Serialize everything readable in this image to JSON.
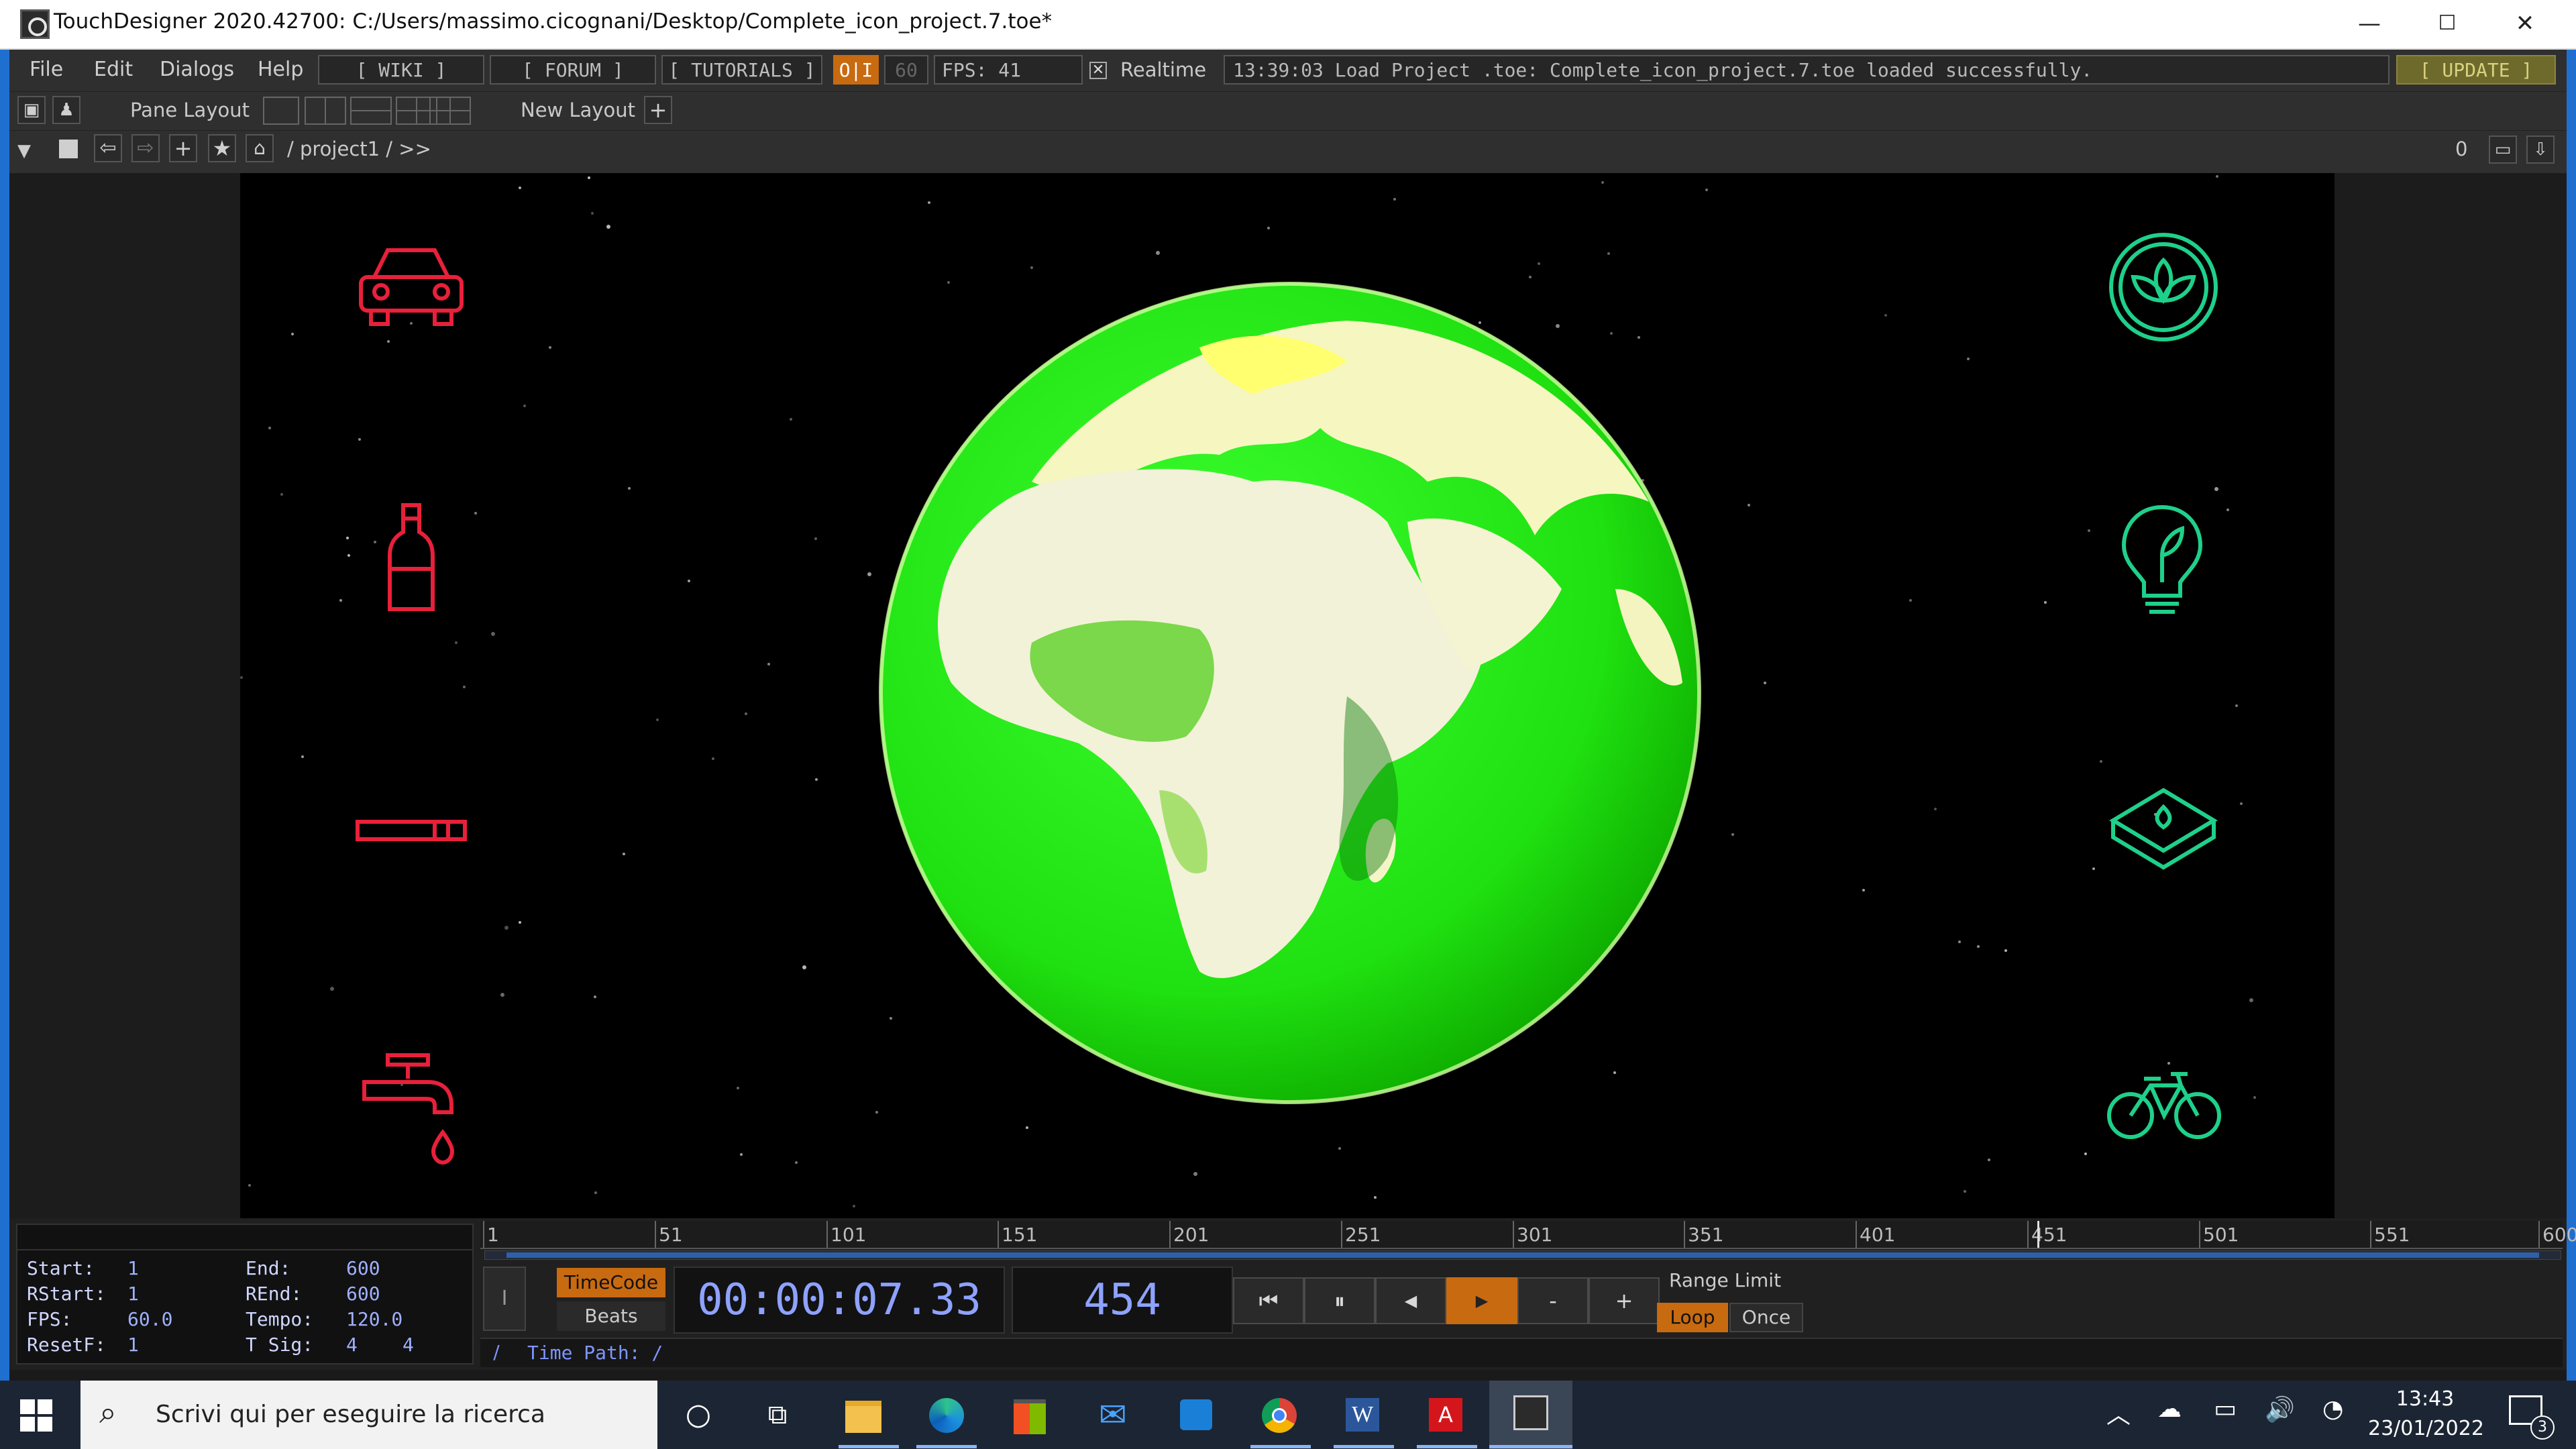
{
  "window": {
    "title": "TouchDesigner 2020.42700: C:/Users/massimo.cicognani/Desktop/Complete_icon_project.7.toe*",
    "controls": {
      "minimize": "—",
      "maximize": "☐",
      "close": "✕"
    }
  },
  "menu": {
    "items": [
      "File",
      "Edit",
      "Dialogs",
      "Help"
    ],
    "wiki": "[ WIKI ]",
    "forum": "[ FORUM ]",
    "tutorials": "[ TUTORIALS ]",
    "oi": "O|I",
    "fps_cap": "60",
    "fps": "FPS:  41",
    "realtime": "Realtime",
    "status": "13:39:03 Load Project .toe: Complete_icon_project.7.toe loaded successfully.",
    "update": "[ UPDATE ]"
  },
  "toolbar": {
    "pane_layout": "Pane Layout",
    "new_layout": "New Layout",
    "add": "+"
  },
  "pathbar": {
    "path": "/ project1 / >>",
    "right_value": "0"
  },
  "viewer": {
    "left_icons": [
      "car-icon",
      "bottle-icon",
      "cigarette-icon",
      "faucet-icon"
    ],
    "right_icons": [
      "leaf-circle-icon",
      "eco-bulb-icon",
      "eco-box-icon",
      "bicycle-icon"
    ],
    "accent_left": "#e8203a",
    "accent_right": "#1fd08a",
    "globe_color": "#22e000"
  },
  "timeline": {
    "ruler_labels": [
      "1",
      "51",
      "101",
      "151",
      "201",
      "251",
      "301",
      "351",
      "401",
      "451",
      "501",
      "551",
      "600"
    ],
    "stats": {
      "start_label": "Start:",
      "start": "1",
      "end_label": "End:",
      "end": "600",
      "rstart_label": "RStart:",
      "rstart": "1",
      "rend_label": "REnd:",
      "rend": "600",
      "fps_label": "FPS:",
      "fps": "60.0",
      "tempo_label": "Tempo:",
      "tempo": "120.0",
      "resetf_label": "ResetF:",
      "resetf": "1",
      "tsig_label": "T Sig:",
      "tsig_a": "4",
      "tsig_b": "4"
    },
    "timecode_label": "TimeCode",
    "beats_label": "Beats",
    "timecode": "00:00:07.33",
    "frame": "454",
    "current_frame": 454,
    "total_frames": 600,
    "range_limit": "Range Limit",
    "loop": "Loop",
    "once": "Once",
    "timepath_slash": "/",
    "time_path": "Time Path: /",
    "marker_i": "I",
    "minus": "-",
    "plus": "+"
  },
  "taskbar": {
    "search_placeholder": "Scrivi qui per eseguire la ricerca",
    "time": "13:43",
    "date": "23/01/2022",
    "notifications": "3"
  }
}
